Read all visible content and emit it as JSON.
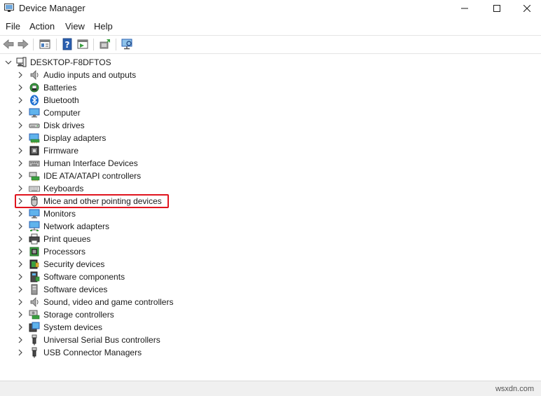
{
  "window": {
    "title": "Device Manager",
    "icon": "device-manager-icon",
    "controls": [
      "minimize-icon",
      "maximize-icon",
      "close-icon"
    ]
  },
  "menu": {
    "items": [
      {
        "label": "File"
      },
      {
        "label": "Action"
      },
      {
        "label": "View"
      },
      {
        "label": "Help"
      }
    ]
  },
  "toolbar": {
    "buttons": [
      {
        "icon": "back-arrow-icon"
      },
      {
        "icon": "forward-arrow-icon"
      },
      {
        "icon": "properties-icon"
      },
      {
        "icon": "help-icon"
      },
      {
        "icon": "show-hidden-icon"
      },
      {
        "icon": "update-driver-icon"
      },
      {
        "icon": "scan-hardware-icon"
      }
    ]
  },
  "tree": {
    "root": {
      "label": "DESKTOP-F8DFTOS",
      "icon": "computer-icon",
      "expanded": true
    },
    "categories": [
      {
        "label": "Audio inputs and outputs",
        "icon": "speaker-icon"
      },
      {
        "label": "Batteries",
        "icon": "battery-icon"
      },
      {
        "label": "Bluetooth",
        "icon": "bluetooth-icon"
      },
      {
        "label": "Computer",
        "icon": "monitor-icon"
      },
      {
        "label": "Disk drives",
        "icon": "disk-drive-icon"
      },
      {
        "label": "Display adapters",
        "icon": "display-adapter-icon"
      },
      {
        "label": "Firmware",
        "icon": "firmware-icon"
      },
      {
        "label": "Human Interface Devices",
        "icon": "hid-icon"
      },
      {
        "label": "IDE ATA/ATAPI controllers",
        "icon": "ide-controller-icon"
      },
      {
        "label": "Keyboards",
        "icon": "keyboard-icon"
      },
      {
        "label": "Mice and other pointing devices",
        "icon": "mouse-icon",
        "highlighted": true
      },
      {
        "label": "Monitors",
        "icon": "monitor-icon"
      },
      {
        "label": "Network adapters",
        "icon": "network-adapter-icon"
      },
      {
        "label": "Print queues",
        "icon": "printer-icon"
      },
      {
        "label": "Processors",
        "icon": "processor-icon"
      },
      {
        "label": "Security devices",
        "icon": "security-device-icon"
      },
      {
        "label": "Software components",
        "icon": "software-component-icon"
      },
      {
        "label": "Software devices",
        "icon": "software-device-icon"
      },
      {
        "label": "Sound, video and game controllers",
        "icon": "speaker-icon"
      },
      {
        "label": "Storage controllers",
        "icon": "storage-controller-icon"
      },
      {
        "label": "System devices",
        "icon": "system-device-icon"
      },
      {
        "label": "Universal Serial Bus controllers",
        "icon": "usb-icon"
      },
      {
        "label": "USB Connector Managers",
        "icon": "usb-icon"
      }
    ]
  },
  "status": {
    "watermark": "wsxdn.com"
  },
  "colors": {
    "highlight": "#e0141e",
    "accent": "#0078d4"
  }
}
